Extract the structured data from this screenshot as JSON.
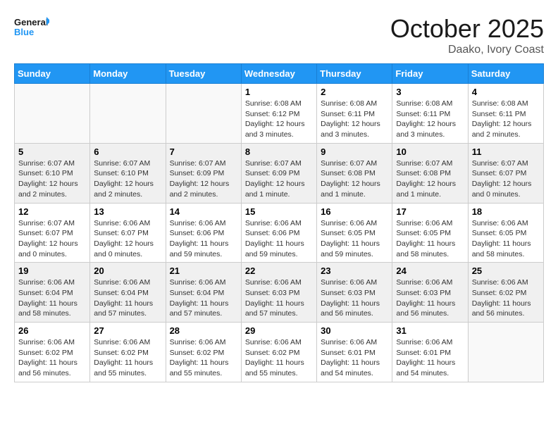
{
  "logo": {
    "line1": "General",
    "line2": "Blue"
  },
  "title": "October 2025",
  "subtitle": "Daako, Ivory Coast",
  "weekdays": [
    "Sunday",
    "Monday",
    "Tuesday",
    "Wednesday",
    "Thursday",
    "Friday",
    "Saturday"
  ],
  "weeks": [
    [
      {
        "day": "",
        "info": ""
      },
      {
        "day": "",
        "info": ""
      },
      {
        "day": "",
        "info": ""
      },
      {
        "day": "1",
        "info": "Sunrise: 6:08 AM\nSunset: 6:12 PM\nDaylight: 12 hours\nand 3 minutes."
      },
      {
        "day": "2",
        "info": "Sunrise: 6:08 AM\nSunset: 6:11 PM\nDaylight: 12 hours\nand 3 minutes."
      },
      {
        "day": "3",
        "info": "Sunrise: 6:08 AM\nSunset: 6:11 PM\nDaylight: 12 hours\nand 3 minutes."
      },
      {
        "day": "4",
        "info": "Sunrise: 6:08 AM\nSunset: 6:11 PM\nDaylight: 12 hours\nand 2 minutes."
      }
    ],
    [
      {
        "day": "5",
        "info": "Sunrise: 6:07 AM\nSunset: 6:10 PM\nDaylight: 12 hours\nand 2 minutes."
      },
      {
        "day": "6",
        "info": "Sunrise: 6:07 AM\nSunset: 6:10 PM\nDaylight: 12 hours\nand 2 minutes."
      },
      {
        "day": "7",
        "info": "Sunrise: 6:07 AM\nSunset: 6:09 PM\nDaylight: 12 hours\nand 2 minutes."
      },
      {
        "day": "8",
        "info": "Sunrise: 6:07 AM\nSunset: 6:09 PM\nDaylight: 12 hours\nand 1 minute."
      },
      {
        "day": "9",
        "info": "Sunrise: 6:07 AM\nSunset: 6:08 PM\nDaylight: 12 hours\nand 1 minute."
      },
      {
        "day": "10",
        "info": "Sunrise: 6:07 AM\nSunset: 6:08 PM\nDaylight: 12 hours\nand 1 minute."
      },
      {
        "day": "11",
        "info": "Sunrise: 6:07 AM\nSunset: 6:07 PM\nDaylight: 12 hours\nand 0 minutes."
      }
    ],
    [
      {
        "day": "12",
        "info": "Sunrise: 6:07 AM\nSunset: 6:07 PM\nDaylight: 12 hours\nand 0 minutes."
      },
      {
        "day": "13",
        "info": "Sunrise: 6:06 AM\nSunset: 6:07 PM\nDaylight: 12 hours\nand 0 minutes."
      },
      {
        "day": "14",
        "info": "Sunrise: 6:06 AM\nSunset: 6:06 PM\nDaylight: 11 hours\nand 59 minutes."
      },
      {
        "day": "15",
        "info": "Sunrise: 6:06 AM\nSunset: 6:06 PM\nDaylight: 11 hours\nand 59 minutes."
      },
      {
        "day": "16",
        "info": "Sunrise: 6:06 AM\nSunset: 6:05 PM\nDaylight: 11 hours\nand 59 minutes."
      },
      {
        "day": "17",
        "info": "Sunrise: 6:06 AM\nSunset: 6:05 PM\nDaylight: 11 hours\nand 58 minutes."
      },
      {
        "day": "18",
        "info": "Sunrise: 6:06 AM\nSunset: 6:05 PM\nDaylight: 11 hours\nand 58 minutes."
      }
    ],
    [
      {
        "day": "19",
        "info": "Sunrise: 6:06 AM\nSunset: 6:04 PM\nDaylight: 11 hours\nand 58 minutes."
      },
      {
        "day": "20",
        "info": "Sunrise: 6:06 AM\nSunset: 6:04 PM\nDaylight: 11 hours\nand 57 minutes."
      },
      {
        "day": "21",
        "info": "Sunrise: 6:06 AM\nSunset: 6:04 PM\nDaylight: 11 hours\nand 57 minutes."
      },
      {
        "day": "22",
        "info": "Sunrise: 6:06 AM\nSunset: 6:03 PM\nDaylight: 11 hours\nand 57 minutes."
      },
      {
        "day": "23",
        "info": "Sunrise: 6:06 AM\nSunset: 6:03 PM\nDaylight: 11 hours\nand 56 minutes."
      },
      {
        "day": "24",
        "info": "Sunrise: 6:06 AM\nSunset: 6:03 PM\nDaylight: 11 hours\nand 56 minutes."
      },
      {
        "day": "25",
        "info": "Sunrise: 6:06 AM\nSunset: 6:02 PM\nDaylight: 11 hours\nand 56 minutes."
      }
    ],
    [
      {
        "day": "26",
        "info": "Sunrise: 6:06 AM\nSunset: 6:02 PM\nDaylight: 11 hours\nand 56 minutes."
      },
      {
        "day": "27",
        "info": "Sunrise: 6:06 AM\nSunset: 6:02 PM\nDaylight: 11 hours\nand 55 minutes."
      },
      {
        "day": "28",
        "info": "Sunrise: 6:06 AM\nSunset: 6:02 PM\nDaylight: 11 hours\nand 55 minutes."
      },
      {
        "day": "29",
        "info": "Sunrise: 6:06 AM\nSunset: 6:02 PM\nDaylight: 11 hours\nand 55 minutes."
      },
      {
        "day": "30",
        "info": "Sunrise: 6:06 AM\nSunset: 6:01 PM\nDaylight: 11 hours\nand 54 minutes."
      },
      {
        "day": "31",
        "info": "Sunrise: 6:06 AM\nSunset: 6:01 PM\nDaylight: 11 hours\nand 54 minutes."
      },
      {
        "day": "",
        "info": ""
      }
    ]
  ]
}
